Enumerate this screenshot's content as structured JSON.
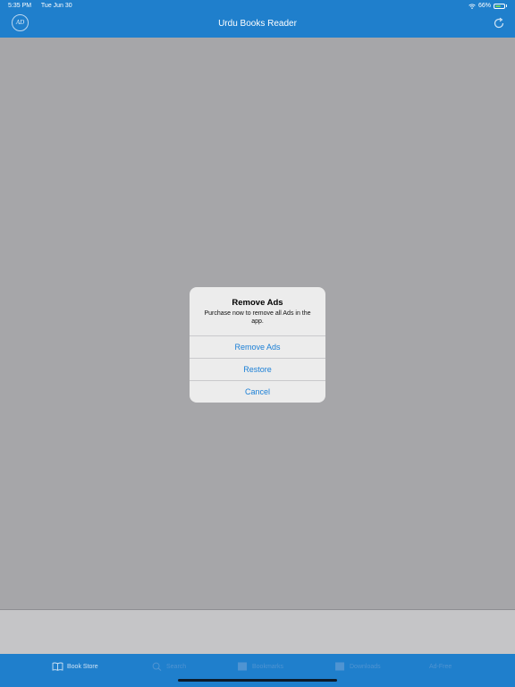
{
  "status_bar": {
    "time": "5:35 PM",
    "date": "Tue Jun 30",
    "battery": "66%",
    "battery_level": 0.66
  },
  "nav": {
    "logo_text": "AD",
    "title": "Urdu Books Reader"
  },
  "alert": {
    "title": "Remove Ads",
    "message": "Purchase now to remove all Ads in the app.",
    "buttons": {
      "remove_ads": "Remove Ads",
      "restore": "Restore",
      "cancel": "Cancel"
    }
  },
  "tabs": [
    {
      "label": "Book Store",
      "icon": "book-icon"
    },
    {
      "label": "Search",
      "icon": "search-icon"
    },
    {
      "label": "Bookmarks",
      "icon": "bookmark-icon"
    },
    {
      "label": "Downloads",
      "icon": "downloads-icon"
    },
    {
      "label": "Ad-Free",
      "icon": "ad-free-icon"
    }
  ],
  "colors": {
    "accent": "#1f7fcc",
    "link": "#1a7fd6",
    "overlay": "#a6a6a9"
  }
}
